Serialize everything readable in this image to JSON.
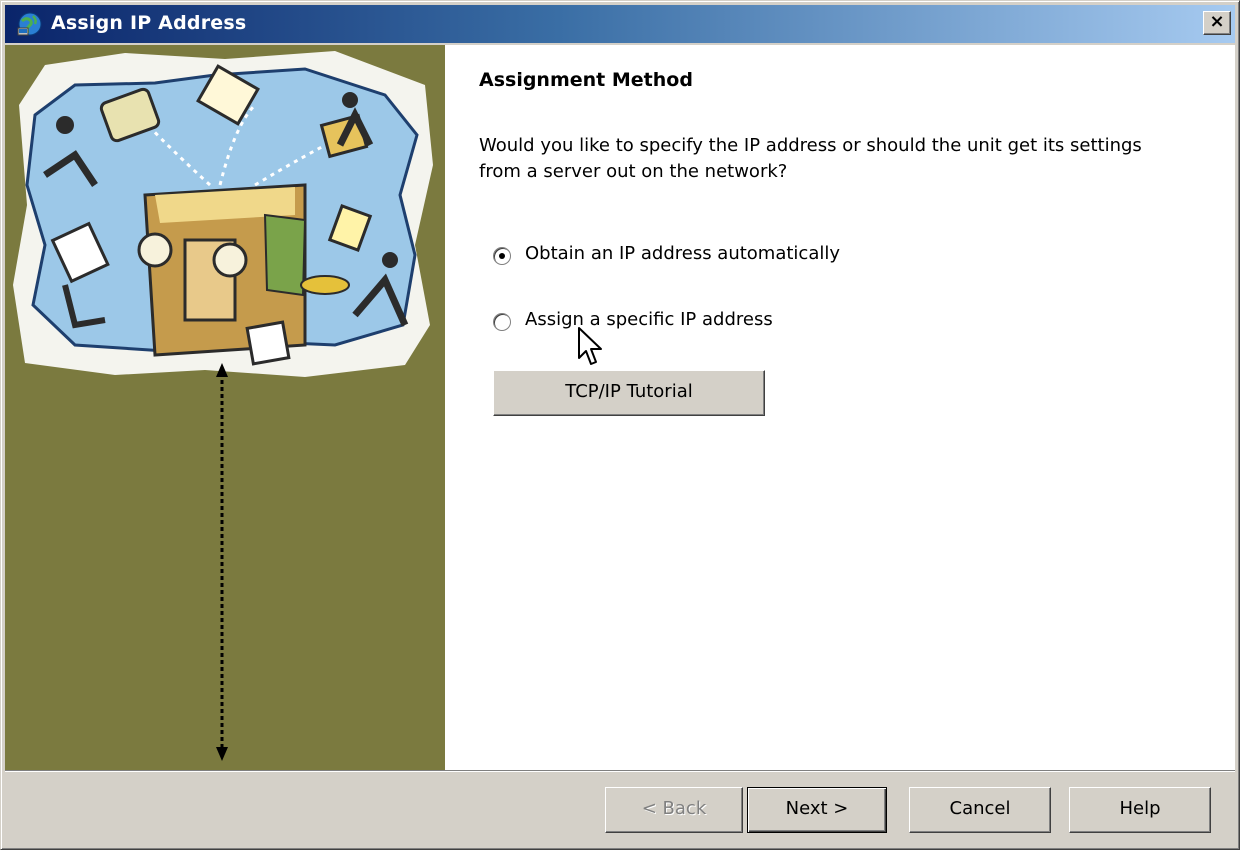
{
  "window": {
    "title": "Assign IP Address",
    "close_glyph": "×",
    "icon": "network-globe-icon"
  },
  "side_panel": {
    "background_color": "#7b7a3f",
    "illustration": "network-illustration"
  },
  "main": {
    "heading": "Assignment Method",
    "question": "Would you like to specify the IP address or should the unit get its settings from a server out on the network?",
    "options": [
      {
        "label": "Obtain an IP address automatically",
        "selected": true
      },
      {
        "label": "Assign a specific IP address",
        "selected": false
      }
    ],
    "tutorial_button": "TCP/IP Tutorial"
  },
  "footer": {
    "back_label": "< Back",
    "next_label": "Next >",
    "cancel_label": "Cancel",
    "help_label": "Help"
  },
  "colors": {
    "titlebar_start": "#0a246a",
    "titlebar_end": "#a6caf0",
    "dialog_face": "#d4d0c8",
    "side_panel": "#7b7a3f"
  }
}
